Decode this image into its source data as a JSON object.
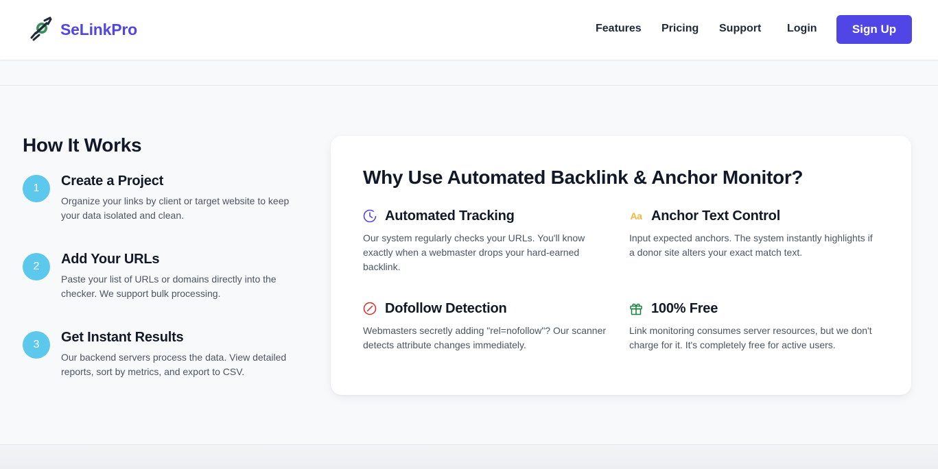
{
  "header": {
    "brand": "SeLinkPro",
    "nav": [
      "Features",
      "Pricing",
      "Support",
      "Login"
    ],
    "signup_label": "Sign Up"
  },
  "colors": {
    "accent": "#4f46e5",
    "step_circle": "#5bc8ec",
    "icon_clock": "#4f46e5",
    "icon_anchor": "#f4b63f",
    "icon_nofollow": "#dc2626",
    "icon_gift": "#15803d"
  },
  "how_it_works": {
    "title": "How It Works",
    "steps": [
      {
        "number": "1",
        "title": "Create a Project",
        "desc": "Organize your links by client or target website to keep your data isolated and clean."
      },
      {
        "number": "2",
        "title": "Add Your URLs",
        "desc": "Paste your list of URLs or domains directly into the checker. We support bulk processing."
      },
      {
        "number": "3",
        "title": "Get Instant Results",
        "desc": "Our backend servers process the data. View detailed reports, sort by metrics, and export to CSV."
      }
    ]
  },
  "why": {
    "title": "Why Use Automated Backlink & Anchor Monitor?",
    "features": [
      {
        "icon": "clock-icon",
        "title": "Automated Tracking",
        "desc": "Our system regularly checks your URLs. You'll know exactly when a webmaster drops your hard-earned backlink."
      },
      {
        "icon": "text-aa-icon",
        "icon_text": "Aa",
        "title": "Anchor Text Control",
        "desc": "Input expected anchors. The system instantly highlights if a donor site alters your exact match text."
      },
      {
        "icon": "nofollow-icon",
        "title": "Dofollow Detection",
        "desc": "Webmasters secretly adding \"rel=nofollow\"? Our scanner detects attribute changes immediately."
      },
      {
        "icon": "gift-icon",
        "title": "100% Free",
        "desc": "Link monitoring consumes server resources, but we don't charge for it. It's completely free for active users."
      }
    ]
  }
}
